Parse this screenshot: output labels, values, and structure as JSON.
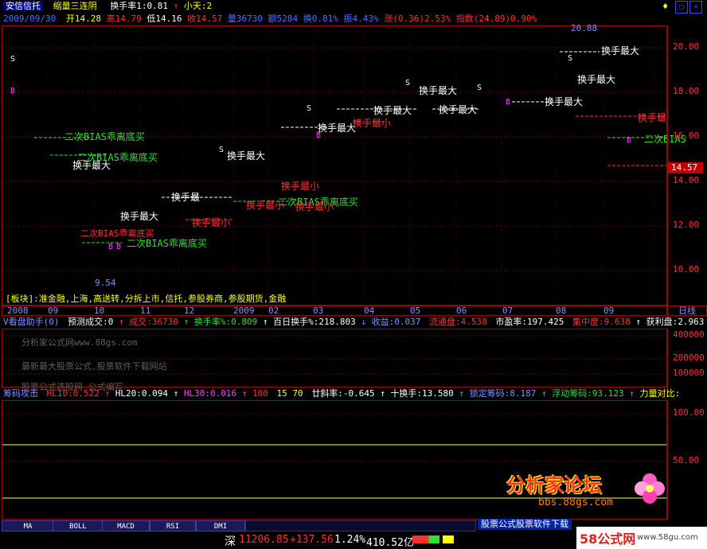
{
  "header": {
    "stock_name": "安信信托",
    "indicator": "缩量三连阴",
    "turnover_label": "换手率1:0.81",
    "small_day": "小天:2",
    "date": "2009/09/30",
    "open": "开14.28",
    "high": "高14.79",
    "low": "低14.16",
    "close": "收14.57",
    "volume": "量36730",
    "amount": "额5284",
    "turnover": "换0.81%",
    "amplitude": "振4.43%",
    "change": "涨(0.36)2.53%",
    "index": "指数(24.89)0.90%"
  },
  "price_axis": {
    "ticks": [
      "20.00",
      "18.00",
      "16.00",
      "14.00",
      "12.00",
      "10.00"
    ],
    "current": "14.57"
  },
  "price_labels": {
    "high": "20.88",
    "low": "9.54",
    "marks": {
      "s": "S",
      "b": "B"
    },
    "annotations": [
      "二次BIAS乖离底买",
      "换手最大",
      "换手最大",
      "换手最小",
      "换手最大",
      "换手最小",
      "换手最大",
      "换手最大",
      "换手最大",
      "换手最大",
      "换手最大",
      "换手最小",
      "二次BIAS乖离底买",
      "换手最",
      "换手最小",
      "二次BIAS",
      "二次BIAS乖离底买",
      "二次BIAS乖离底买",
      "换手最小",
      "换手最大",
      "换手最大",
      "二次BIAS乖离底买",
      "换手最"
    ]
  },
  "board_text": "[板块]:准金融,上海,高送转,分拆上市,信托,参股券商,参股期货,金融",
  "x_axis": {
    "labels": [
      "2008",
      "09",
      "10",
      "11",
      "12",
      "2009",
      "02",
      "03",
      "04",
      "05",
      "06",
      "07",
      "08",
      "09"
    ],
    "tab": "日线"
  },
  "vol_panel": {
    "title": "V看盘助手(0)",
    "forecast": "预测成交:0",
    "volume": "成交:36730",
    "turnover_pct": "换手率%:0.809",
    "hundred_day": "百日换手%:218.803",
    "income": "收益:0.037",
    "float_cap": "流通盘:4.538",
    "pe": "市盈率:197.425",
    "concentration": "集中度:9.638",
    "profit_ratio": "获利盘:2.963",
    "ticks": [
      "400000",
      "200000",
      "100000"
    ],
    "watermark1": "分析家公式网www.88gs.com",
    "watermark2": "最新最大股票公式,股票软件下载网站",
    "watermark3": "股票公式选股网 公式编写"
  },
  "chip_panel": {
    "title": "筹码攻击",
    "hl10": "HL10:0.522",
    "hl20": "HL20:0.094",
    "hl30": "HL30:0.016",
    "val100": "100",
    "param": "15 70",
    "slope": "廿斜率:-0.645",
    "ten_turn": "十换手:13.580",
    "locked": "锁定筹码:8.187",
    "floating": "浮动筹码:93.123",
    "force": "力量对比:",
    "ticks": [
      "100.00",
      "50.00"
    ]
  },
  "bottom_tabs": [
    "MA",
    "BOLL",
    "MACD",
    "RSI",
    "DMI"
  ],
  "status": {
    "index_name": "深",
    "index_value": "11206.85",
    "change": "+137.56",
    "pct": "1.24%",
    "amount": "410.52亿"
  },
  "logos": {
    "forum": "分析家论坛",
    "forum_url": "bbs.88gs.com",
    "site_text": "58公式网",
    "site_url": "www.58gu.com",
    "ticker_text": "股票公式股票软件下载"
  },
  "colors": {
    "up": "#ff3030",
    "down": "#30e030",
    "axis": "#a00000",
    "accent": "#ffff00"
  }
}
